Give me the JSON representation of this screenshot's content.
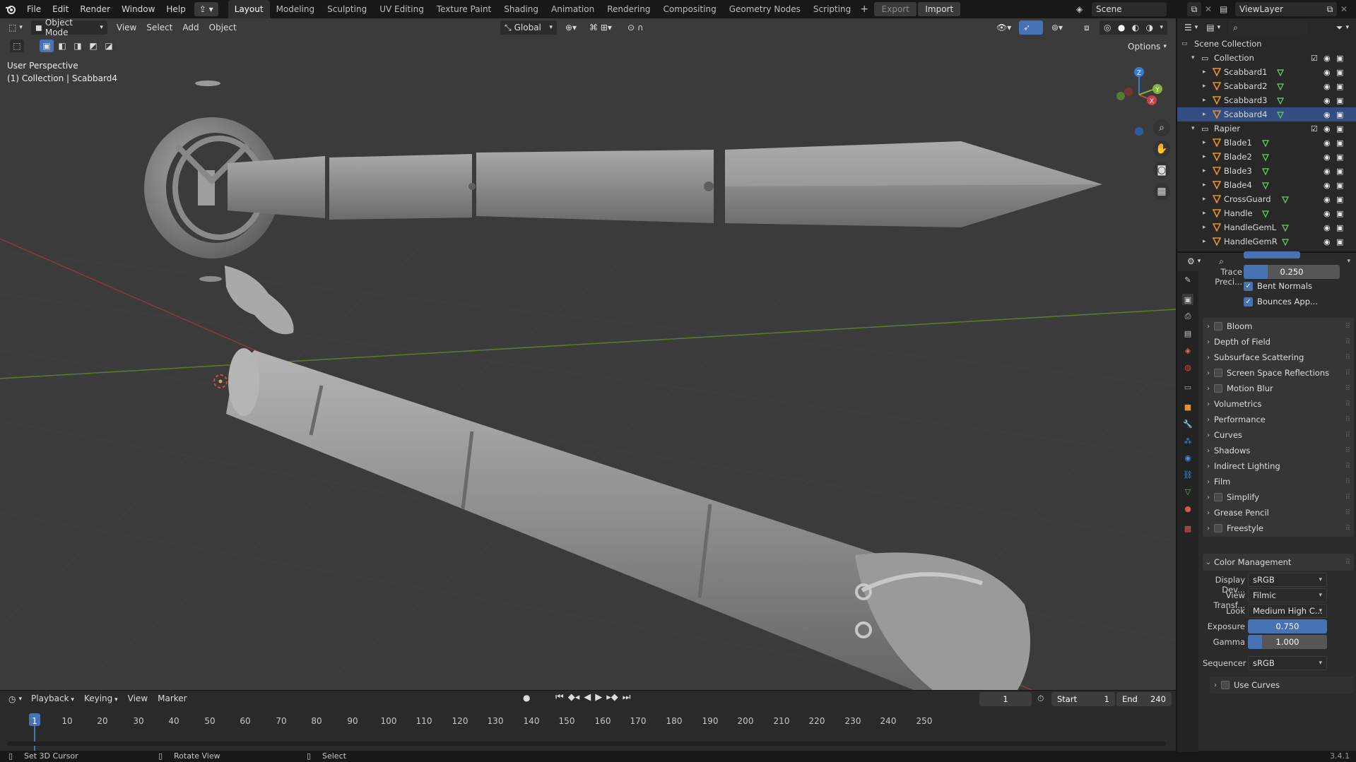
{
  "topbar": {
    "menus": [
      "File",
      "Edit",
      "Render",
      "Window",
      "Help"
    ],
    "workspaces": [
      "Layout",
      "Modeling",
      "Sculpting",
      "UV Editing",
      "Texture Paint",
      "Shading",
      "Animation",
      "Rendering",
      "Compositing",
      "Geometry Nodes",
      "Scripting"
    ],
    "active_workspace": "Layout",
    "export_label": "Export",
    "import_label": "Import",
    "scene_name": "Scene",
    "view_layer_name": "ViewLayer"
  },
  "viewport": {
    "mode": "Object Mode",
    "menus": [
      "View",
      "Select",
      "Add",
      "Object"
    ],
    "orientation": "Global",
    "options_label": "Options",
    "view_name": "User Perspective",
    "context_info": "(1) Collection | Scabbard4",
    "gizmo_axes": {
      "x": "X",
      "y": "Y",
      "z": "Z"
    }
  },
  "timeline": {
    "menus": [
      "Playback",
      "Keying",
      "View",
      "Marker"
    ],
    "current_frame": "1",
    "start_label": "Start",
    "start_value": "1",
    "end_label": "End",
    "end_value": "240",
    "ruler": [
      "1",
      "10",
      "20",
      "30",
      "40",
      "50",
      "60",
      "70",
      "80",
      "90",
      "100",
      "110",
      "120",
      "130",
      "140",
      "150",
      "160",
      "170",
      "180",
      "190",
      "200",
      "210",
      "220",
      "230",
      "240",
      "250"
    ]
  },
  "statusbar": {
    "hint1": "Set 3D Cursor",
    "hint2": "Rotate View",
    "hint3": "Select",
    "version": "3.4.1"
  },
  "outliner": {
    "root": "Scene Collection",
    "collections": [
      {
        "name": "Collection",
        "objects": [
          "Scabbard1",
          "Scabbard2",
          "Scabbard3",
          "Scabbard4"
        ]
      },
      {
        "name": "Rapier",
        "objects": [
          "Blade1",
          "Blade2",
          "Blade3",
          "Blade4",
          "CrossGuard",
          "Handle",
          "HandleGemL",
          "HandleGemR"
        ]
      }
    ]
  },
  "properties": {
    "trace_precision_label": "Trace Preci...",
    "trace_precision_value": "0.250",
    "bent_normals_label": "Bent Normals",
    "bounces_label": "Bounces App...",
    "panels": [
      {
        "label": "Bloom",
        "checkbox": true
      },
      {
        "label": "Depth of Field",
        "checkbox": false
      },
      {
        "label": "Subsurface Scattering",
        "checkbox": false
      },
      {
        "label": "Screen Space Reflections",
        "checkbox": true
      },
      {
        "label": "Motion Blur",
        "checkbox": true
      },
      {
        "label": "Volumetrics",
        "checkbox": false
      },
      {
        "label": "Performance",
        "checkbox": false
      },
      {
        "label": "Curves",
        "checkbox": false
      },
      {
        "label": "Shadows",
        "checkbox": false
      },
      {
        "label": "Indirect Lighting",
        "checkbox": false
      },
      {
        "label": "Film",
        "checkbox": false
      },
      {
        "label": "Simplify",
        "checkbox": true
      },
      {
        "label": "Grease Pencil",
        "checkbox": false
      },
      {
        "label": "Freestyle",
        "checkbox": true
      }
    ],
    "color_management": {
      "label": "Color Management",
      "display_device_label": "Display Dev...",
      "display_device_value": "sRGB",
      "view_transform_label": "View Transf...",
      "view_transform_value": "Filmic",
      "look_label": "Look",
      "look_value": "Medium High C...",
      "exposure_label": "Exposure",
      "exposure_value": "0.750",
      "gamma_label": "Gamma",
      "gamma_value": "1.000",
      "sequencer_label": "Sequencer",
      "sequencer_value": "sRGB",
      "use_curves_label": "Use Curves"
    }
  },
  "colors": {
    "accent": "#4772b3",
    "viewport_bg": "#3b3b3b",
    "x_axis": "#c7434b",
    "y_axis": "#84b33a",
    "z_axis": "#3a7bd1"
  }
}
